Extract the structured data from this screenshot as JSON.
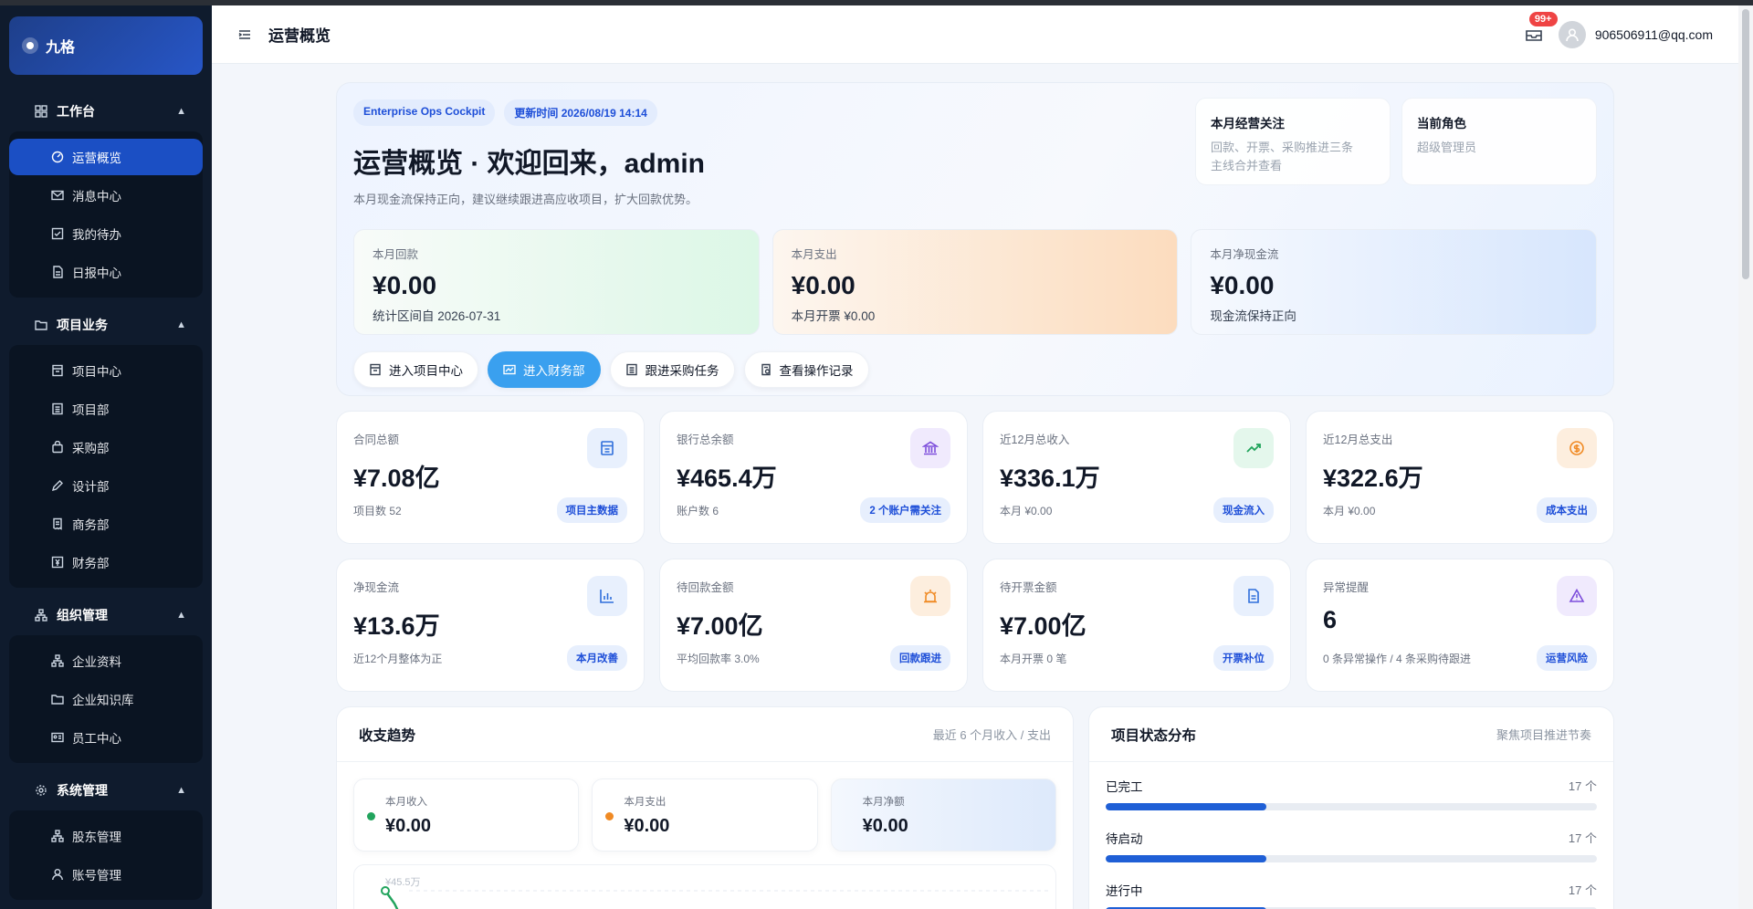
{
  "brand": {
    "name": "九格"
  },
  "sidebar": {
    "groups": [
      {
        "label": "工作台",
        "icon": "grid-icon",
        "items": [
          {
            "label": "运营概览",
            "icon": "dashboard-icon",
            "active": true
          },
          {
            "label": "消息中心",
            "icon": "mail-icon"
          },
          {
            "label": "我的待办",
            "icon": "checkbox-icon"
          },
          {
            "label": "日报中心",
            "icon": "document-icon"
          }
        ]
      },
      {
        "label": "项目业务",
        "icon": "folder-icon",
        "items": [
          {
            "label": "项目中心",
            "icon": "building-icon"
          },
          {
            "label": "项目部",
            "icon": "list-icon"
          },
          {
            "label": "采购部",
            "icon": "bag-icon"
          },
          {
            "label": "设计部",
            "icon": "pen-icon"
          },
          {
            "label": "商务部",
            "icon": "receipt-icon"
          },
          {
            "label": "财务部",
            "icon": "finance-icon"
          }
        ]
      },
      {
        "label": "组织管理",
        "icon": "org-icon",
        "items": [
          {
            "label": "企业资料",
            "icon": "org-icon"
          },
          {
            "label": "企业知识库",
            "icon": "folder-icon"
          },
          {
            "label": "员工中心",
            "icon": "id-card-icon"
          }
        ]
      },
      {
        "label": "系统管理",
        "icon": "gear-icon",
        "items": [
          {
            "label": "股东管理",
            "icon": "org-icon"
          },
          {
            "label": "账号管理",
            "icon": "user-icon"
          }
        ]
      }
    ]
  },
  "header": {
    "title": "运营概览",
    "badge": "99+",
    "user": "906506911@qq.com"
  },
  "hero": {
    "chip1": "Enterprise Ops Cockpit",
    "chip2": "更新时间 2026/08/19 14:14",
    "title": "运营概览 · 欢迎回来，admin",
    "subtitle": "本月现金流保持正向，建议继续跟进高应收项目，扩大回款优势。",
    "note1": {
      "title": "本月经营关注",
      "desc1": "回款、开票、采购推进三条",
      "desc2": "主线合并查看"
    },
    "note2": {
      "title": "当前角色",
      "desc": "超级管理员"
    },
    "kpis": [
      {
        "label": "本月回款",
        "value": "¥0.00",
        "note": "统计区间自 2026-07-31"
      },
      {
        "label": "本月支出",
        "value": "¥0.00",
        "note": "本月开票 ¥0.00"
      },
      {
        "label": "本月净现金流",
        "value": "¥0.00",
        "note": "现金流保持正向"
      }
    ],
    "actions": [
      {
        "label": "进入项目中心"
      },
      {
        "label": "进入财务部"
      },
      {
        "label": "跟进采购任务"
      },
      {
        "label": "查看操作记录"
      }
    ]
  },
  "stats": [
    {
      "label": "合同总额",
      "value": "¥7.08亿",
      "foot": "项目数 52",
      "tag": "项目主数据",
      "icon": "building-icon",
      "color": "#2f6fdb",
      "bg": "#e8f0fd"
    },
    {
      "label": "银行总余额",
      "value": "¥465.4万",
      "foot": "账户数 6",
      "tag": "2 个账户需关注",
      "icon": "bank-icon",
      "color": "#7c4ddb",
      "bg": "#f0eafd"
    },
    {
      "label": "近12月总收入",
      "value": "¥336.1万",
      "foot": "本月 ¥0.00",
      "tag": "现金流入",
      "icon": "trend-up-icon",
      "color": "#1fa35a",
      "bg": "#e4f7ec"
    },
    {
      "label": "近12月总支出",
      "value": "¥322.6万",
      "foot": "本月 ¥0.00",
      "tag": "成本支出",
      "icon": "coin-icon",
      "color": "#f08a24",
      "bg": "#fdeede"
    },
    {
      "label": "净现金流",
      "value": "¥13.6万",
      "foot": "近12个月整体为正",
      "tag": "本月改善",
      "icon": "bar-chart-icon",
      "color": "#2f6fdb",
      "bg": "#e8f0fd"
    },
    {
      "label": "待回款金额",
      "value": "¥7.00亿",
      "foot": "平均回款率 3.0%",
      "tag": "回款跟进",
      "icon": "alarm-icon",
      "color": "#f08a24",
      "bg": "#fdeede"
    },
    {
      "label": "待开票金额",
      "value": "¥7.00亿",
      "foot": "本月开票 0 笔",
      "tag": "开票补位",
      "icon": "invoice-icon",
      "color": "#2f6fdb",
      "bg": "#e8f0fd"
    },
    {
      "label": "异常提醒",
      "value": "6",
      "foot": "0 条异常操作 / 4 条采购待跟进",
      "tag": "运营风险",
      "icon": "warning-icon",
      "color": "#7c4ddb",
      "bg": "#f0eafd"
    }
  ],
  "trend": {
    "title": "收支趋势",
    "subtitle": "最近 6 个月收入 / 支出",
    "minis": [
      {
        "label": "本月收入",
        "value": "¥0.00",
        "dot": "#22a45d"
      },
      {
        "label": "本月支出",
        "value": "¥0.00",
        "dot": "#f08a24"
      },
      {
        "label": "本月净额",
        "value": "¥0.00"
      }
    ],
    "ytop": "¥45.5万"
  },
  "status": {
    "title": "项目状态分布",
    "subtitle": "聚焦项目推进节奏",
    "items": [
      {
        "label": "已完工",
        "count": "17 个",
        "fraction": 0.327
      },
      {
        "label": "待启动",
        "count": "17 个",
        "fraction": 0.327
      },
      {
        "label": "进行中",
        "count": "17 个",
        "fraction": 0.327
      }
    ]
  }
}
